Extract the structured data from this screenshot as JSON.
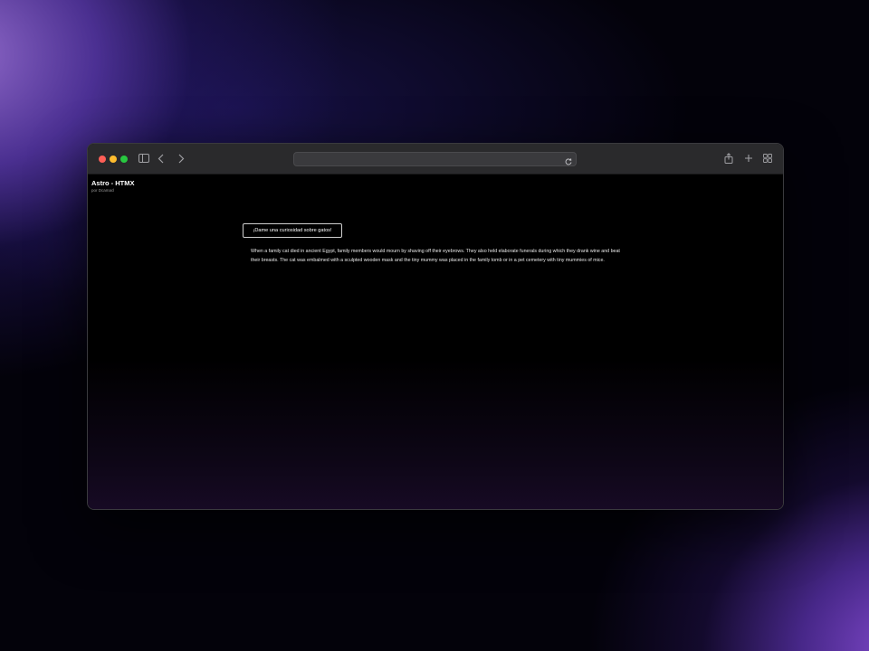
{
  "page": {
    "site_title": "Astro - HTMX",
    "byline": "por Dcamacl",
    "button_label": "¡Dame una curiosidad sobre gatos!",
    "fact": "When a family cat died in ancient Egypt, family members would mourn by shaving off their eyebrows. They also held elaborate funerals during which they drank wine and beat their breasts. The cat was embalmed with a sculpted wooden mask and the tiny mummy was placed in the family tomb or in a pet cemetery with tiny mummies of mice."
  },
  "browser": {
    "address": "",
    "icons": [
      "sidebar-icon",
      "chevron-left-icon",
      "chevron-right-icon",
      "reload-icon",
      "share-icon",
      "plus-icon",
      "tab-grid-icon"
    ]
  },
  "colors": {
    "close": "#fe5f57",
    "minimize": "#febc2e",
    "maximize": "#28c840",
    "toolbar": "#2a2a2c",
    "page_background": "#000000"
  }
}
